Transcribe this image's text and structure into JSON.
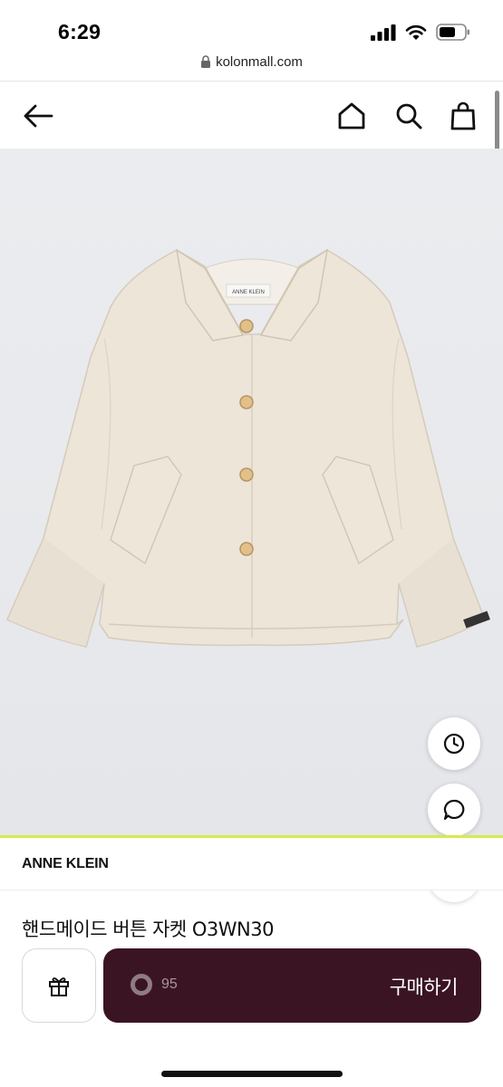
{
  "status": {
    "time": "6:29"
  },
  "browser": {
    "url": "kolonmall.com"
  },
  "header": {
    "back_icon": "arrow-left-icon",
    "home_icon": "home-icon",
    "search_icon": "search-icon",
    "cart_icon": "shopping-bag-icon"
  },
  "product": {
    "image_label": "ANNE KLEIN",
    "brand": "ANNE KLEIN",
    "title": "핸드메이드 버튼 자켓 O3WN30"
  },
  "floating": {
    "recent_icon": "clock-icon",
    "chat_icon": "chat-bubble-icon",
    "top_icon": "arrow-up-icon"
  },
  "purchase_bar": {
    "gift_icon": "gift-icon",
    "count": "95",
    "buy_label": "구매하기"
  },
  "colors": {
    "buy_button": "#3b1424",
    "accent_line": "#d7ea4a",
    "jacket": "#ece5d8"
  }
}
